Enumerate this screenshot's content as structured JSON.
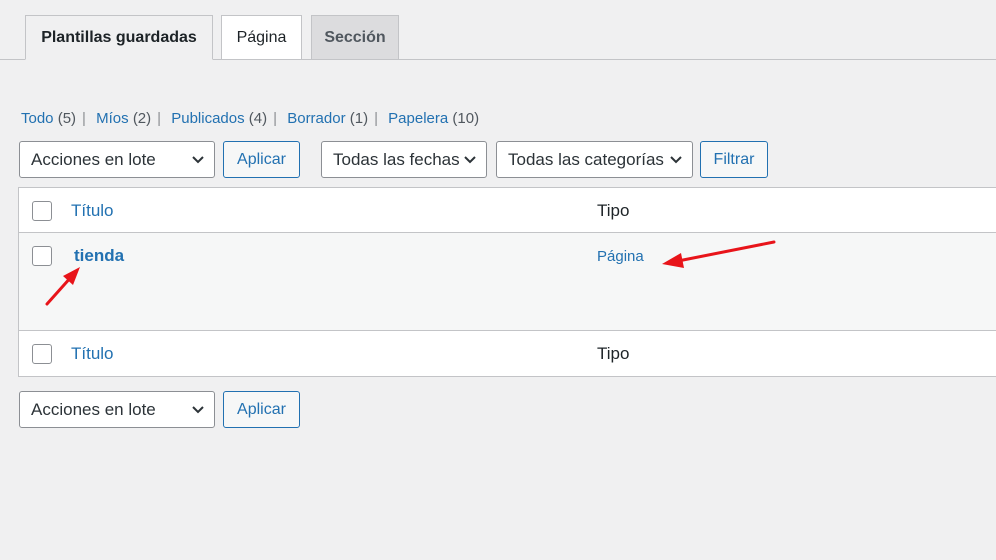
{
  "tabs": [
    {
      "label": "Plantillas guardadas",
      "active": true
    },
    {
      "label": "Página",
      "active": false
    },
    {
      "label": "Sección",
      "active": false
    }
  ],
  "filters": {
    "all": {
      "label": "Todo",
      "count": "(5)"
    },
    "mine": {
      "label": "Míos",
      "count": "(2)"
    },
    "published": {
      "label": "Publicados",
      "count": "(4)"
    },
    "draft": {
      "label": "Borrador",
      "count": "(1)"
    },
    "trash": {
      "label": "Papelera",
      "count": "(10)"
    },
    "separator": "|"
  },
  "controls": {
    "bulk_actions": "Acciones en lote",
    "apply": "Aplicar",
    "all_dates": "Todas las fechas",
    "all_categories": "Todas las categorías",
    "filter": "Filtrar"
  },
  "table": {
    "columns": {
      "title": "Título",
      "type": "Tipo"
    },
    "rows": [
      {
        "title": "tienda",
        "type": "Página"
      }
    ]
  },
  "colors": {
    "link": "#2271b1",
    "annotation_arrow": "#e8141a"
  }
}
